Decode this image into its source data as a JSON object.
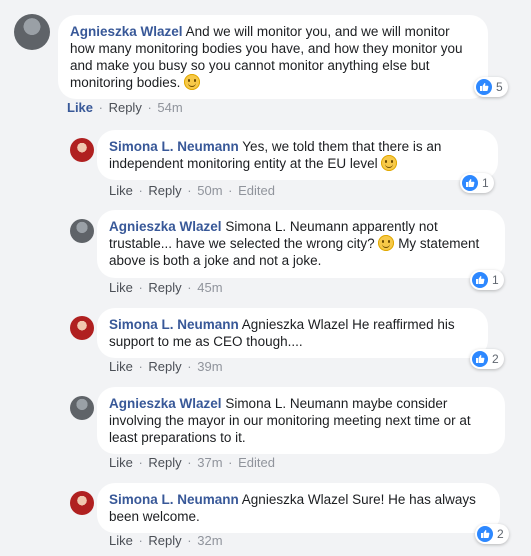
{
  "comments": [
    {
      "author": "Agnieszka Wlazel",
      "text": "And we will monitor you, and we will monitor how many monitoring bodies you have, and how they monitor you and make you busy so you cannot monitor anything else but monitoring bodies.",
      "reaction_count": "5",
      "like": "Like",
      "reply": "Reply",
      "time": "54m",
      "edited": ""
    },
    {
      "author": "Simona L. Neumann",
      "text": "Yes, we told them that there is an independent monitoring entity at the EU level",
      "reaction_count": "1",
      "like": "Like",
      "reply": "Reply",
      "time": "50m",
      "edited": "Edited"
    },
    {
      "author": "Agnieszka Wlazel",
      "text": "Simona L. Neumann apparently not trustable... have we selected the wrong city?",
      "text2": "My statement above is both a joke and not a joke.",
      "reaction_count": "1",
      "like": "Like",
      "reply": "Reply",
      "time": "45m",
      "edited": ""
    },
    {
      "author": "Simona L. Neumann",
      "text": "Agnieszka Wlazel He reaffirmed his support to me as CEO though....",
      "reaction_count": "2",
      "like": "Like",
      "reply": "Reply",
      "time": "39m",
      "edited": ""
    },
    {
      "author": "Agnieszka Wlazel",
      "text": "Simona L. Neumann maybe consider involving the mayor in our monitoring meeting next time or at least preparations to it.",
      "reaction_count": "",
      "like": "Like",
      "reply": "Reply",
      "time": "37m",
      "edited": "Edited"
    },
    {
      "author": "Simona L. Neumann",
      "text": "Agnieszka Wlazel Sure! He has always been welcome.",
      "reaction_count": "2",
      "like": "Like",
      "reply": "Reply",
      "time": "32m",
      "edited": ""
    }
  ]
}
